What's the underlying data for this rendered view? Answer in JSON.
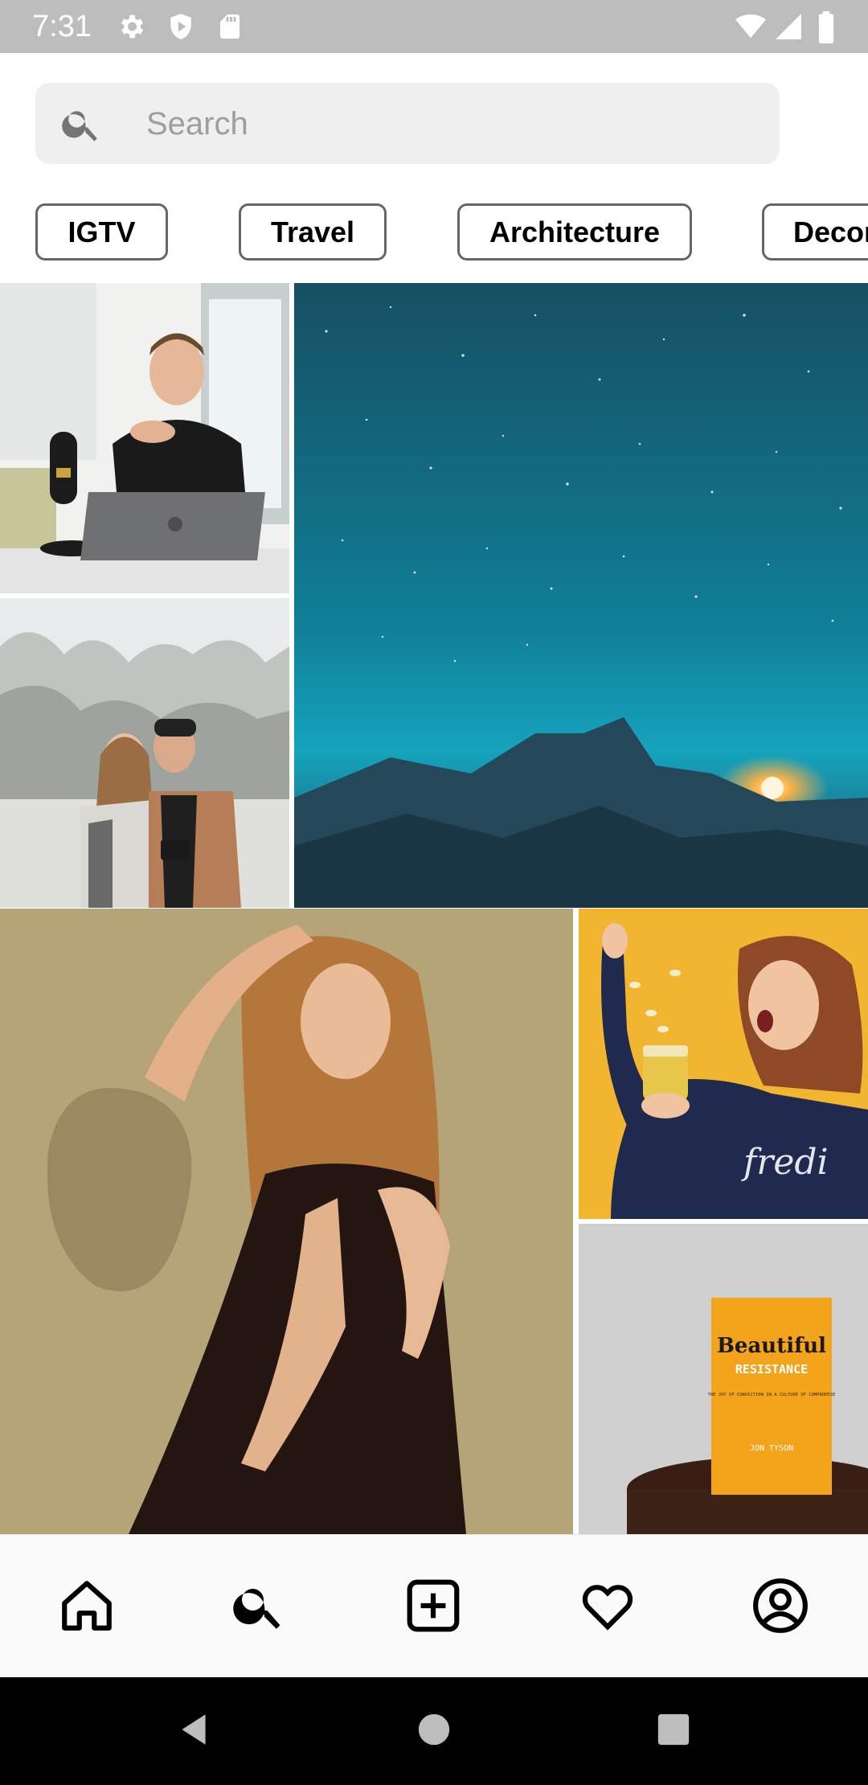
{
  "status_bar": {
    "time": "7:31",
    "left_icons": [
      "gear-icon",
      "play-protect-icon",
      "sd-card-icon"
    ],
    "right_icons": [
      "wifi-icon",
      "signal-icon",
      "battery-icon"
    ],
    "background": "#bdbdbd"
  },
  "search": {
    "placeholder": "Search",
    "icon": "search-icon"
  },
  "chips": [
    {
      "label": "IGTV"
    },
    {
      "label": "Travel"
    },
    {
      "label": "Architecture"
    },
    {
      "label": "Decor"
    }
  ],
  "grid": {
    "photos": [
      {
        "name": "photo-man-with-microphone",
        "description_colors": [
          "#f2f2f2",
          "#1b1b1b"
        ]
      },
      {
        "name": "photo-starry-sky-half-dome",
        "description_colors": [
          "#0f6b80",
          "#1a3a4a"
        ]
      },
      {
        "name": "photo-couple-in-snow",
        "description_colors": [
          "#e9ecec",
          "#6b6b6b"
        ]
      },
      {
        "name": "photo-woman-long-hair",
        "description_colors": [
          "#b7a47a",
          "#1c0f0d"
        ]
      },
      {
        "name": "photo-woman-with-jar",
        "description_colors": [
          "#f2b530",
          "#1f2a4a"
        ]
      },
      {
        "name": "photo-book-beautiful-resistance",
        "description_colors": [
          "#cfcfcf",
          "#f3a21b"
        ]
      }
    ],
    "book_title": "Beautiful",
    "book_subtitle": "RESISTANCE",
    "book_tagline": "THE JOY OF CONVICTION IN A CULTURE OF COMPROMISE",
    "book_author": "JON TYSON",
    "shirt_text": "fredi"
  },
  "bottom_nav": {
    "items": [
      {
        "icon": "home-icon"
      },
      {
        "icon": "search-icon"
      },
      {
        "icon": "add-post-icon"
      },
      {
        "icon": "heart-icon"
      },
      {
        "icon": "profile-icon"
      }
    ]
  },
  "system_nav": {
    "items": [
      {
        "icon": "back-icon"
      },
      {
        "icon": "home-circle-icon"
      },
      {
        "icon": "recents-icon"
      }
    ]
  }
}
